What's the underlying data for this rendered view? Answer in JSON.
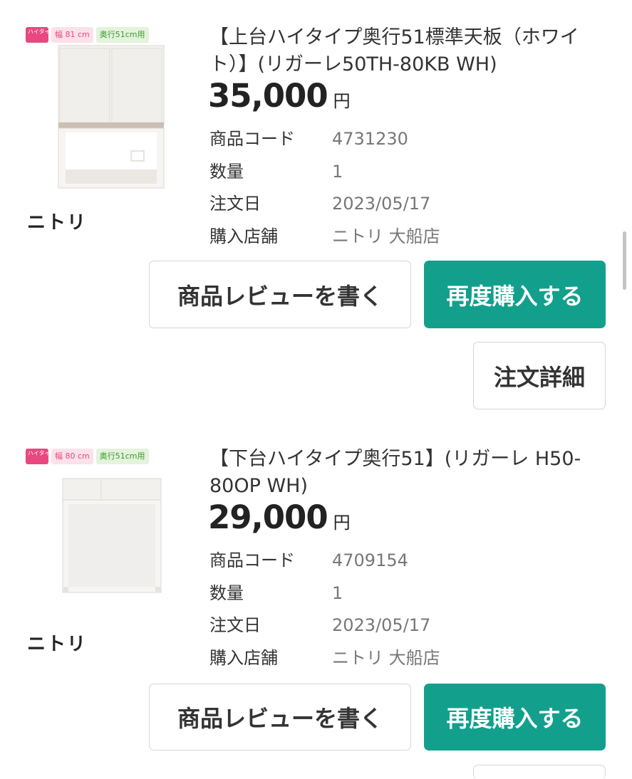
{
  "colors": {
    "accent": "#12a08d",
    "badge_pink": "#e8477f",
    "badge_green": "#3e9a2c"
  },
  "labels": {
    "product_code": "商品コード",
    "quantity": "数量",
    "order_date": "注文日",
    "store": "購入店舗",
    "yen": "円",
    "review_button": "商品レビューを書く",
    "rebuy_button": "再度購入する",
    "order_detail_button": "注文詳細"
  },
  "items": [
    {
      "badges": {
        "type": "ハイタイプ",
        "width": "幅 81 cm",
        "depth": "奥行51cm用"
      },
      "brand": "ニトリ",
      "title": "【上台ハイタイプ奥行51標準天板（ホワイト）】(リガーレ50TH-80KB WH)",
      "price": "35,000",
      "product_code": "4731230",
      "quantity": "1",
      "order_date": "2023/05/17",
      "store": "ニトリ 大船店"
    },
    {
      "badges": {
        "type": "ハイタイプ",
        "width": "幅 80 cm",
        "depth": "奥行51cm用"
      },
      "brand": "ニトリ",
      "title": "【下台ハイタイプ奥行51】(リガーレ H50-80OP WH)",
      "price": "29,000",
      "product_code": "4709154",
      "quantity": "1",
      "order_date": "2023/05/17",
      "store": "ニトリ 大船店"
    }
  ]
}
